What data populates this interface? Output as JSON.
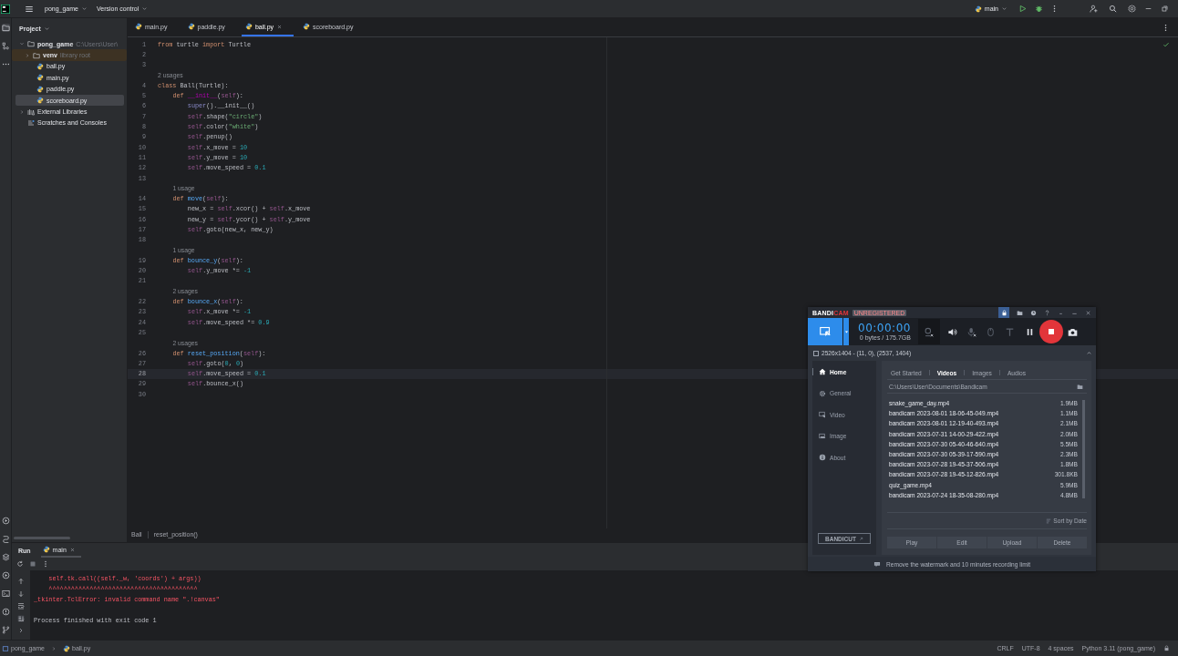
{
  "title_bar": {
    "project": "pong_game",
    "vcs": "Version control",
    "run_config": "main"
  },
  "project_panel": {
    "title": "Project",
    "tree": [
      {
        "label": "pong_game",
        "hint": "C:\\Users\\User\\",
        "kind": "folder",
        "expanded": true,
        "selected": false,
        "children": [
          {
            "label": "venv",
            "hint": "library root",
            "kind": "library",
            "expanded": false,
            "selected": false
          },
          {
            "label": "ball.py",
            "kind": "file",
            "selected": false
          },
          {
            "label": "main.py",
            "kind": "file",
            "selected": false
          },
          {
            "label": "paddle.py",
            "kind": "file",
            "selected": false
          },
          {
            "label": "scoreboard.py",
            "kind": "file",
            "selected": true
          }
        ]
      },
      {
        "label": "External Libraries",
        "kind": "libraries",
        "expanded": false,
        "selected": false
      },
      {
        "label": "Scratches and Consoles",
        "kind": "scratches",
        "selected": false
      }
    ]
  },
  "editor": {
    "tabs": [
      {
        "label": "main.py",
        "selected": false
      },
      {
        "label": "paddle.py",
        "selected": false
      },
      {
        "label": "ball.py",
        "selected": true
      },
      {
        "label": "scoreboard.py",
        "selected": false
      }
    ],
    "lines": [
      {
        "kind": "line",
        "number": "1",
        "current": false,
        "tokens": [
          {
            "kind": "keyword",
            "text": "from"
          },
          {
            "kind": "plain",
            "text": " turtle "
          },
          {
            "kind": "keyword",
            "text": "import"
          },
          {
            "kind": "plain",
            "text": " Turtle"
          }
        ]
      },
      {
        "kind": "line",
        "number": "2",
        "current": false
      },
      {
        "kind": "line",
        "number": "3",
        "current": false
      },
      {
        "kind": "hint",
        "text": "2 usages"
      },
      {
        "kind": "line",
        "number": "4",
        "current": false,
        "tokens": [
          {
            "kind": "keyword",
            "text": "class"
          },
          {
            "kind": "plain",
            "text": " Ball(Turtle):"
          }
        ],
        "children": [
          {
            "kind": "line",
            "number": "5",
            "current": false,
            "tokens": [
              {
                "kind": "keyword",
                "text": "def "
              },
              {
                "kind": "dunder",
                "text": "__init__"
              },
              {
                "kind": "plain",
                "text": "("
              },
              {
                "kind": "self",
                "text": "self"
              },
              {
                "kind": "plain",
                "text": "):"
              }
            ],
            "children": [
              {
                "kind": "line",
                "number": "6",
                "current": false,
                "tokens": [
                  {
                    "kind": "builtin",
                    "text": "super"
                  },
                  {
                    "kind": "plain",
                    "text": "().__init__()"
                  }
                ]
              },
              {
                "kind": "line",
                "number": "7",
                "current": false,
                "tokens": [
                  {
                    "kind": "self",
                    "text": "self"
                  },
                  {
                    "kind": "plain",
                    "text": ".shape("
                  },
                  {
                    "kind": "string",
                    "text": "\"circle\""
                  },
                  {
                    "kind": "plain",
                    "text": ")"
                  }
                ]
              },
              {
                "kind": "line",
                "number": "8",
                "current": false,
                "tokens": [
                  {
                    "kind": "self",
                    "text": "self"
                  },
                  {
                    "kind": "plain",
                    "text": ".color("
                  },
                  {
                    "kind": "string",
                    "text": "\"white\""
                  },
                  {
                    "kind": "plain",
                    "text": ")"
                  }
                ]
              },
              {
                "kind": "line",
                "number": "9",
                "current": false,
                "tokens": [
                  {
                    "kind": "self",
                    "text": "self"
                  },
                  {
                    "kind": "plain",
                    "text": ".penup()"
                  }
                ]
              },
              {
                "kind": "line",
                "number": "10",
                "current": false,
                "tokens": [
                  {
                    "kind": "self",
                    "text": "self"
                  },
                  {
                    "kind": "plain",
                    "text": ".x_move = "
                  },
                  {
                    "kind": "number",
                    "text": "10"
                  }
                ]
              },
              {
                "kind": "line",
                "number": "11",
                "current": false,
                "tokens": [
                  {
                    "kind": "self",
                    "text": "self"
                  },
                  {
                    "kind": "plain",
                    "text": ".y_move = "
                  },
                  {
                    "kind": "number",
                    "text": "10"
                  }
                ]
              },
              {
                "kind": "line",
                "number": "12",
                "current": false,
                "tokens": [
                  {
                    "kind": "self",
                    "text": "self"
                  },
                  {
                    "kind": "plain",
                    "text": ".move_speed = "
                  },
                  {
                    "kind": "number",
                    "text": "0.1"
                  }
                ]
              }
            ]
          },
          {
            "kind": "line",
            "number": "13",
            "current": false
          },
          {
            "kind": "hint",
            "text": "1 usage"
          },
          {
            "kind": "line",
            "number": "14",
            "current": false,
            "tokens": [
              {
                "kind": "keyword",
                "text": "def "
              },
              {
                "kind": "function",
                "text": "move"
              },
              {
                "kind": "plain",
                "text": "("
              },
              {
                "kind": "self",
                "text": "self"
              },
              {
                "kind": "plain",
                "text": "):"
              }
            ],
            "children": [
              {
                "kind": "line",
                "number": "15",
                "current": false,
                "tokens": [
                  {
                    "kind": "plain",
                    "text": "new_x = "
                  },
                  {
                    "kind": "self",
                    "text": "self"
                  },
                  {
                    "kind": "plain",
                    "text": ".xcor() + "
                  },
                  {
                    "kind": "self",
                    "text": "self"
                  },
                  {
                    "kind": "plain",
                    "text": ".x_move"
                  }
                ]
              },
              {
                "kind": "line",
                "number": "16",
                "current": false,
                "tokens": [
                  {
                    "kind": "plain",
                    "text": "new_y = "
                  },
                  {
                    "kind": "self",
                    "text": "self"
                  },
                  {
                    "kind": "plain",
                    "text": ".ycor() + "
                  },
                  {
                    "kind": "self",
                    "text": "self"
                  },
                  {
                    "kind": "plain",
                    "text": ".y_move"
                  }
                ]
              },
              {
                "kind": "line",
                "number": "17",
                "current": false,
                "tokens": [
                  {
                    "kind": "self",
                    "text": "self"
                  },
                  {
                    "kind": "plain",
                    "text": ".goto(new_x, new_y)"
                  }
                ]
              }
            ]
          },
          {
            "kind": "line",
            "number": "18",
            "current": false
          },
          {
            "kind": "hint",
            "text": "1 usage"
          },
          {
            "kind": "line",
            "number": "19",
            "current": false,
            "tokens": [
              {
                "kind": "keyword",
                "text": "def "
              },
              {
                "kind": "function",
                "text": "bounce_y"
              },
              {
                "kind": "plain",
                "text": "("
              },
              {
                "kind": "self",
                "text": "self"
              },
              {
                "kind": "plain",
                "text": "):"
              }
            ],
            "children": [
              {
                "kind": "line",
                "number": "20",
                "current": false,
                "tokens": [
                  {
                    "kind": "self",
                    "text": "self"
                  },
                  {
                    "kind": "plain",
                    "text": ".y_move *= "
                  },
                  {
                    "kind": "number",
                    "text": "-1"
                  }
                ]
              }
            ]
          },
          {
            "kind": "line",
            "number": "21",
            "current": false
          },
          {
            "kind": "hint",
            "text": "2 usages"
          },
          {
            "kind": "line",
            "number": "22",
            "current": false,
            "tokens": [
              {
                "kind": "keyword",
                "text": "def "
              },
              {
                "kind": "function",
                "text": "bounce_x"
              },
              {
                "kind": "plain",
                "text": "("
              },
              {
                "kind": "self",
                "text": "self"
              },
              {
                "kind": "plain",
                "text": "):"
              }
            ],
            "children": [
              {
                "kind": "line",
                "number": "23",
                "current": false,
                "tokens": [
                  {
                    "kind": "self",
                    "text": "self"
                  },
                  {
                    "kind": "plain",
                    "text": ".x_move *= "
                  },
                  {
                    "kind": "number",
                    "text": "-1"
                  }
                ]
              },
              {
                "kind": "line",
                "number": "24",
                "current": false,
                "tokens": [
                  {
                    "kind": "self",
                    "text": "self"
                  },
                  {
                    "kind": "plain",
                    "text": ".move_speed *= "
                  },
                  {
                    "kind": "number",
                    "text": "0.9"
                  }
                ]
              }
            ]
          },
          {
            "kind": "line",
            "number": "25",
            "current": false
          },
          {
            "kind": "hint",
            "text": "2 usages"
          },
          {
            "kind": "line",
            "number": "26",
            "current": false,
            "tokens": [
              {
                "kind": "keyword",
                "text": "def "
              },
              {
                "kind": "function",
                "text": "reset_position"
              },
              {
                "kind": "plain",
                "text": "("
              },
              {
                "kind": "self",
                "text": "self"
              },
              {
                "kind": "plain",
                "text": "):"
              }
            ],
            "children": [
              {
                "kind": "line",
                "number": "27",
                "current": false,
                "tokens": [
                  {
                    "kind": "self",
                    "text": "self"
                  },
                  {
                    "kind": "plain",
                    "text": ".goto("
                  },
                  {
                    "kind": "number",
                    "text": "0"
                  },
                  {
                    "kind": "plain",
                    "text": ", "
                  },
                  {
                    "kind": "number",
                    "text": "0"
                  },
                  {
                    "kind": "plain",
                    "text": ")"
                  }
                ]
              },
              {
                "kind": "line",
                "number": "28",
                "current": true,
                "tokens": [
                  {
                    "kind": "self",
                    "text": "self"
                  },
                  {
                    "kind": "plain",
                    "text": ".move_speed = "
                  },
                  {
                    "kind": "number",
                    "text": "0.1"
                  }
                ]
              },
              {
                "kind": "line",
                "number": "29",
                "current": false,
                "tokens": [
                  {
                    "kind": "self",
                    "text": "self"
                  },
                  {
                    "kind": "plain",
                    "text": ".bounce_x()"
                  }
                ]
              }
            ]
          }
        ]
      },
      {
        "kind": "line",
        "number": "30",
        "current": false
      }
    ],
    "breadcrumb": [
      "Ball",
      "reset_position()"
    ]
  },
  "run_panel": {
    "title": "Run",
    "tabs": [
      {
        "label": "main",
        "selected": true
      }
    ],
    "output": [
      {
        "kind": "error",
        "text": "    self.tk.call((self._w, 'coords') + args))"
      },
      {
        "kind": "error",
        "text": "    ^^^^^^^^^^^^^^^^^^^^^^^^^^^^^^^^^^^^^^^^"
      },
      {
        "kind": "error",
        "text": "_tkinter.TclError: invalid command name \".!canvas\""
      },
      {
        "kind": "info",
        "text": "Process finished with exit code 1"
      }
    ]
  },
  "status_bar": {
    "path": [
      "pong_game",
      "ball.py"
    ],
    "items": [
      "CRLF",
      "UTF-8",
      "4 spaces",
      "Python 3.11 (pong_game)"
    ]
  },
  "recorder": {
    "logo": [
      "BANDI",
      "CAM"
    ],
    "badge": "UNREGISTERED",
    "timer": "00:00:00",
    "size": "0 bytes / 175.7GB",
    "devices": [
      {
        "kind": "webcam",
        "on": false
      },
      {
        "kind": "speaker",
        "on": true
      },
      {
        "kind": "mic",
        "on": false
      },
      {
        "kind": "mouse",
        "on": false
      },
      {
        "kind": "text",
        "on": false
      }
    ],
    "area": "2526x1404 - (11, 0), (2537, 1404)",
    "area_checked": false,
    "nav": [
      {
        "label": "Home",
        "selected": true
      },
      {
        "label": "General",
        "selected": false
      },
      {
        "label": "Video",
        "selected": false
      },
      {
        "label": "Image",
        "selected": false
      },
      {
        "label": "About",
        "selected": false
      }
    ],
    "bandicut": "BANDICUT",
    "tabs": [
      {
        "label": "Get Started",
        "selected": false
      },
      {
        "label": "Videos",
        "selected": true
      },
      {
        "label": "Images",
        "selected": false
      },
      {
        "label": "Audios",
        "selected": false
      }
    ],
    "path": "C:\\Users\\User\\Documents\\Bandicam",
    "files": [
      {
        "name": "snake_game_day.mp4",
        "size": "1.9MB"
      },
      {
        "name": "bandicam 2023-08-01 18-06-45-049.mp4",
        "size": "1.1MB"
      },
      {
        "name": "bandicam 2023-08-01 12-19-40-493.mp4",
        "size": "2.1MB"
      },
      {
        "name": "bandicam 2023-07-31 14-00-29-422.mp4",
        "size": "2.0MB"
      },
      {
        "name": "bandicam 2023-07-30 05-40-46-640.mp4",
        "size": "5.5MB"
      },
      {
        "name": "bandicam 2023-07-30 05-39-17-590.mp4",
        "size": "2.3MB"
      },
      {
        "name": "bandicam 2023-07-28 19-45-37-506.mp4",
        "size": "1.8MB"
      },
      {
        "name": "bandicam 2023-07-28 19-45-12-826.mp4",
        "size": "301.8KB"
      },
      {
        "name": "quiz_game.mp4",
        "size": "5.9MB"
      },
      {
        "name": "bandicam 2023-07-24 18-35-08-280.mp4",
        "size": "4.8MB"
      }
    ],
    "sort": "Sort by Date",
    "actions": [
      "Play",
      "Edit",
      "Upload",
      "Delete"
    ],
    "notice": "Remove the watermark and 10 minutes recording limit"
  }
}
